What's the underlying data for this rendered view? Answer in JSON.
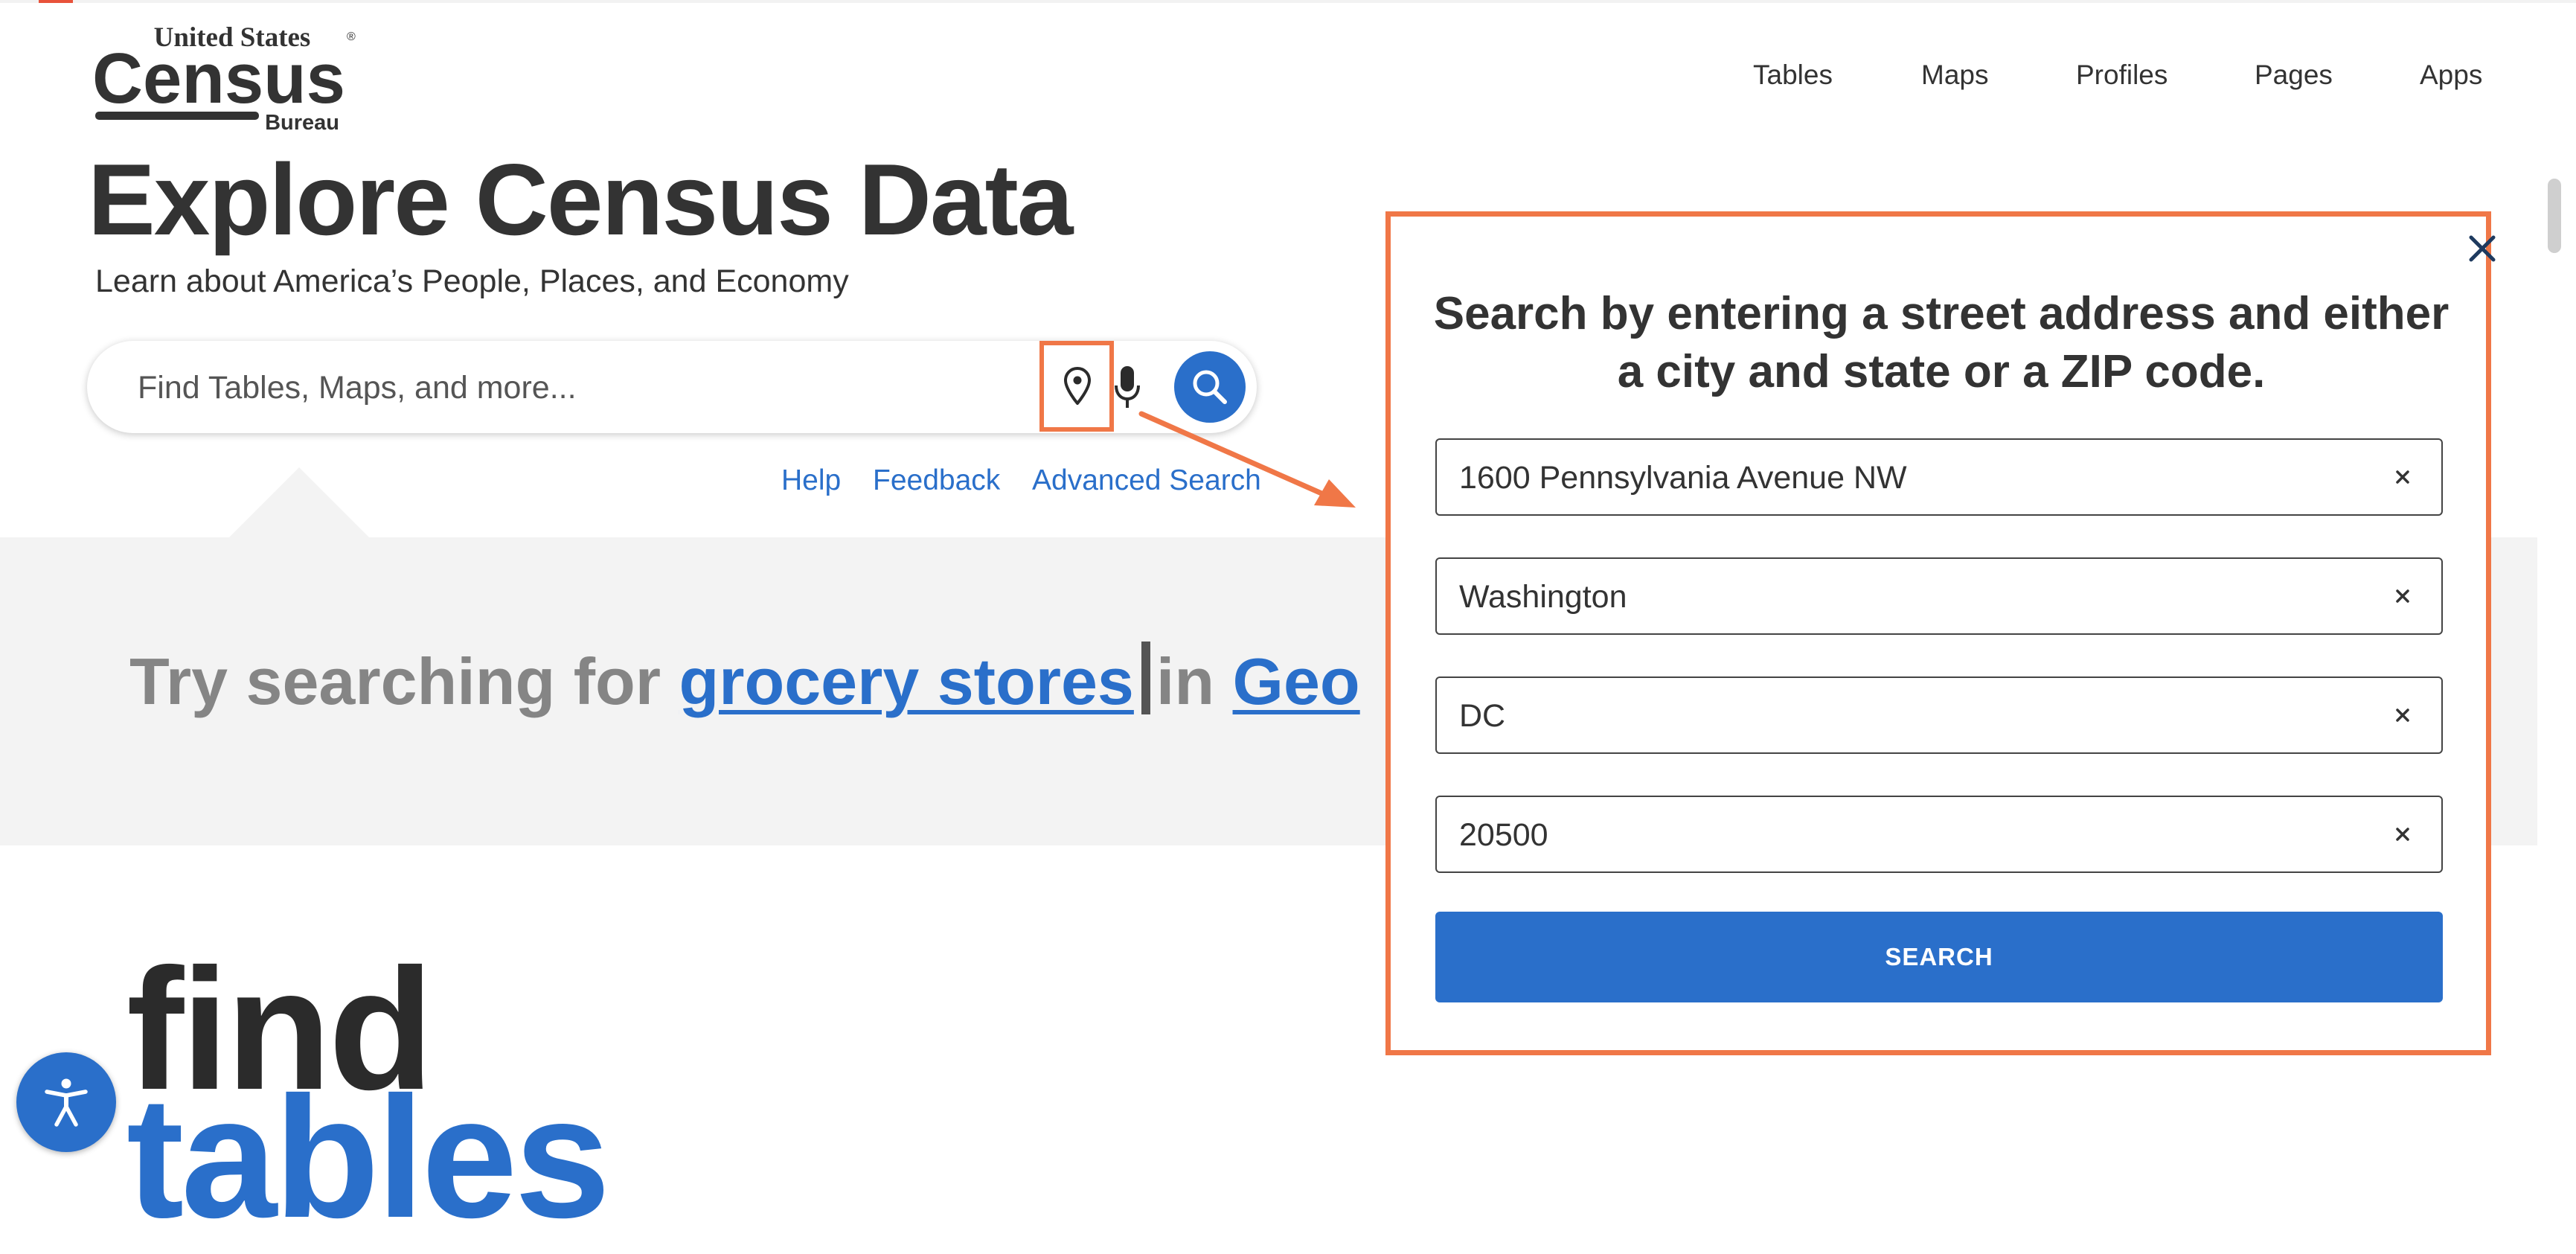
{
  "logo": {
    "line1": "United States",
    "registered": "®",
    "line2": "Census",
    "line3": "Bureau"
  },
  "nav": {
    "items": [
      "Tables",
      "Maps",
      "Profiles",
      "Pages",
      "Apps"
    ]
  },
  "hero": {
    "title": "Explore Census Data",
    "subtitle": "Learn about America’s People, Places, and Economy"
  },
  "search": {
    "placeholder": "Find Tables, Maps, and more...",
    "links": {
      "help": "Help",
      "feedback": "Feedback",
      "advanced": "Advanced Search"
    }
  },
  "suggestion": {
    "prefix": "Try searching for",
    "term": "grocery stores",
    "middle": "in",
    "geo": "Geo"
  },
  "showcase": {
    "word1": "find",
    "word2": "tables"
  },
  "address_modal": {
    "title": "Search by entering a street address and either a city and state or a ZIP code.",
    "street": "1600 Pennsylvania Avenue NW",
    "city": "Washington",
    "state": "DC",
    "zip": "20500",
    "search_label": "SEARCH"
  },
  "colors": {
    "accent": "#2a6fca",
    "annotation": "#f07747",
    "text": "#333333",
    "band": "#f3f3f3"
  }
}
